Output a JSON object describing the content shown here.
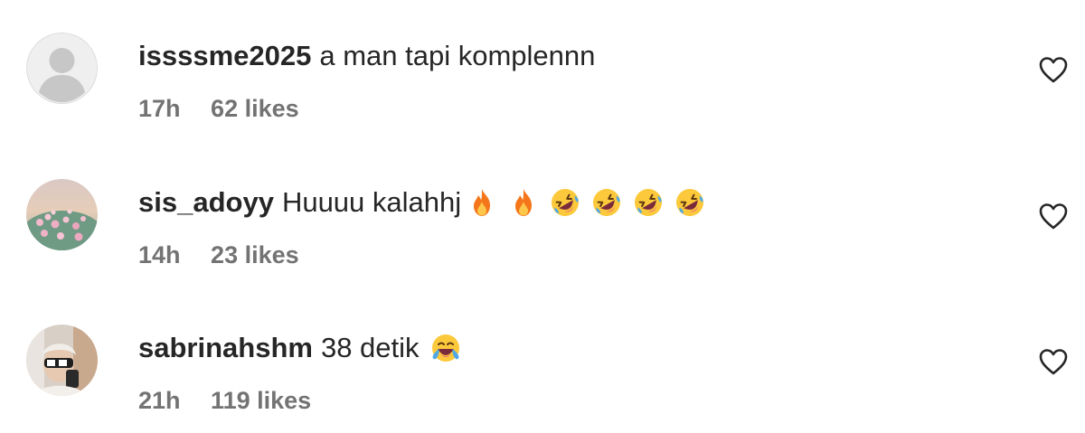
{
  "comments": [
    {
      "username": "issssme2025",
      "text": "a man tapi komplennn",
      "time": "17h",
      "likes": "62 likes",
      "avatar_icon": "default-avatar-icon",
      "emojis": []
    },
    {
      "username": "sis_adoyy",
      "text": "Huuuu kalahhj",
      "time": "14h",
      "likes": "23 likes",
      "avatar_icon": "flowers-avatar",
      "emojis": [
        "fire-emoji",
        "fire-emoji",
        "rolling-laughing-emoji",
        "rolling-laughing-emoji",
        "rolling-laughing-emoji",
        "rolling-laughing-emoji"
      ]
    },
    {
      "username": "sabrinahshm",
      "text": "38 detik",
      "time": "21h",
      "likes": "119 likes",
      "avatar_icon": "person-photo-avatar",
      "emojis": [
        "tears-of-joy-emoji"
      ]
    }
  ],
  "colors": {
    "text": "#262626",
    "meta": "#737373",
    "avatar_placeholder_bg": "#efefef",
    "avatar_placeholder_fg": "#c7c7c7"
  },
  "icons": {
    "like": "heart-outline-icon"
  }
}
